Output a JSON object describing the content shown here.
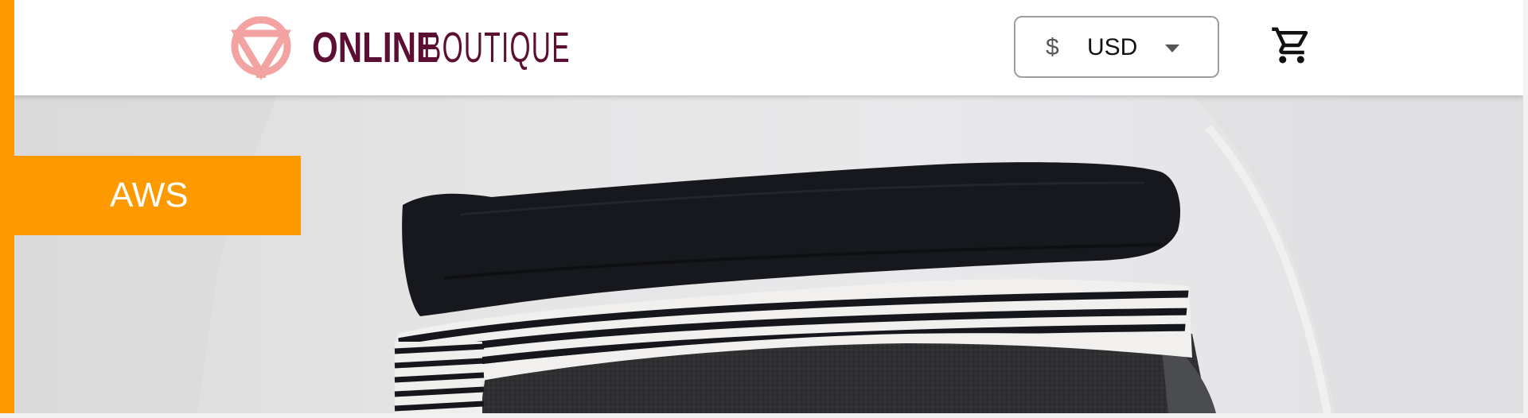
{
  "header": {
    "logo": {
      "strong_text": "ONLINE",
      "light_text": "BOUTIQUE",
      "mark_icon": "boutique-triangle-logo-icon"
    },
    "currency": {
      "symbol": "$",
      "code": "USD",
      "caret_icon": "chevron-down-icon"
    },
    "cart": {
      "icon": "shopping-cart-icon"
    }
  },
  "badge": {
    "label": "AWS"
  },
  "hero": {
    "image": "stacked-folded-shirts-photo"
  },
  "colors": {
    "frame_accent": "#FF9900",
    "brand": "#5C0F33",
    "logo_mark": "#F4A3A3",
    "currency_border": "#9E9E9E"
  }
}
